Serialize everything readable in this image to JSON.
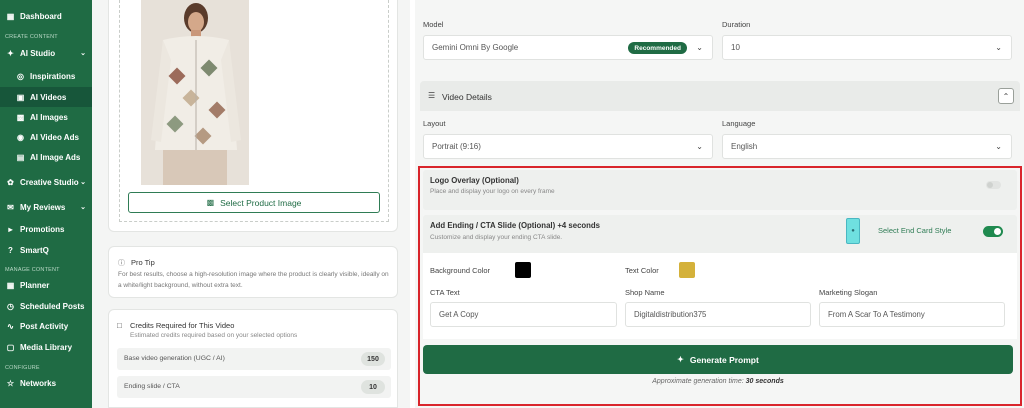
{
  "sidebar": {
    "dashboard": "Dashboard",
    "section_create": "CREATE CONTENT",
    "ai_studio": "AI Studio",
    "inspirations": "Inspirations",
    "ai_videos": "AI Videos",
    "ai_images": "AI Images",
    "ai_video_ads": "AI Video Ads",
    "ai_image_ads": "AI Image Ads",
    "creative_studio": "Creative Studio",
    "my_reviews": "My Reviews",
    "promotions": "Promotions",
    "smartq": "SmartQ",
    "section_manage": "MANAGE CONTENT",
    "planner": "Planner",
    "scheduled_posts": "Scheduled Posts",
    "post_activity": "Post Activity",
    "media_library": "Media Library",
    "section_configure": "CONFIGURE",
    "networks": "Networks"
  },
  "product": {
    "select_button": "Select Product Image"
  },
  "tip": {
    "title": "Pro Tip",
    "text": "For best results, choose a high-resolution image where the product is clearly visible, ideally on a white/light background, without extra text."
  },
  "credits": {
    "title": "Credits Required for This Video",
    "subtitle": "Estimated credits required based on your selected options",
    "rows": [
      {
        "label": "Base video generation (UGC / AI)",
        "value": "150"
      },
      {
        "label": "Ending slide / CTA",
        "value": "10"
      }
    ]
  },
  "settings": {
    "model_label": "Model",
    "model_value": "Gemini Omni By Google",
    "model_badge": "Recommended",
    "duration_label": "Duration",
    "duration_value": "10"
  },
  "video_details": {
    "title": "Video Details",
    "layout_label": "Layout",
    "layout_value": "Portrait (9:16)",
    "language_label": "Language",
    "language_value": "English"
  },
  "logo_overlay": {
    "title": "Logo Overlay (Optional)",
    "subtitle": "Place and display your logo on every frame"
  },
  "ending": {
    "title": "Add Ending / CTA Slide (Optional) +4 seconds",
    "subtitle": "Customize and display your ending CTA slide.",
    "end_card_label": "Select End Card Style",
    "bg_color_label": "Background Color",
    "text_color_label": "Text Color",
    "bg_color": "#000000",
    "text_color": "#d4b13a",
    "cta_label": "CTA Text",
    "cta_value": "Get A Copy",
    "shop_label": "Shop Name",
    "shop_value": "Digitaldistribution375",
    "slogan_label": "Marketing Slogan",
    "slogan_value": "From A Scar To A Testimony"
  },
  "generate": {
    "button": "Generate Prompt",
    "note_prefix": "Approximate generation time:",
    "note_time": "30 seconds"
  },
  "colors": {
    "brand": "#1f6b44",
    "highlight": "#d9252c"
  }
}
